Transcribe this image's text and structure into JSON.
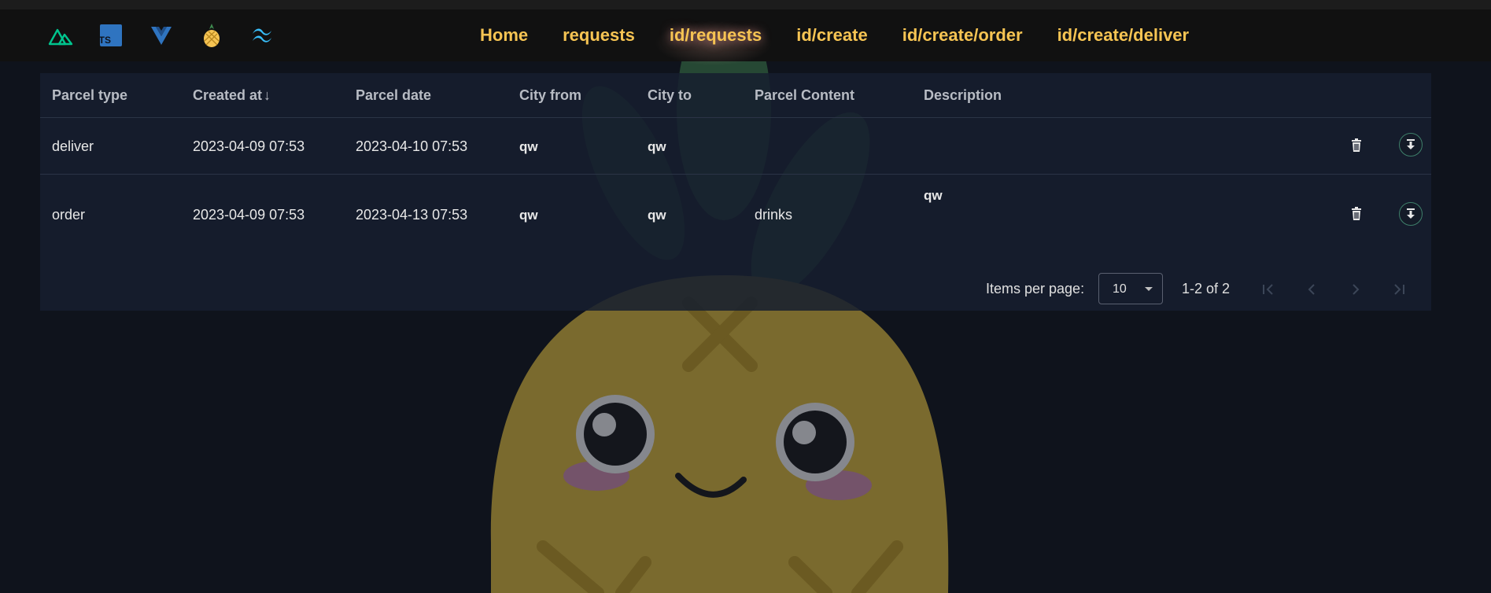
{
  "nav": {
    "logos": [
      {
        "name": "nuxt-logo-icon"
      },
      {
        "name": "typescript-logo-icon",
        "text": "TS"
      },
      {
        "name": "vue-logo-icon"
      },
      {
        "name": "pineapple-logo-icon"
      },
      {
        "name": "tailwind-logo-icon"
      }
    ],
    "links": [
      {
        "label": "Home"
      },
      {
        "label": "requests"
      },
      {
        "label": "id/requests"
      },
      {
        "label": "id/create"
      },
      {
        "label": "id/create/order"
      },
      {
        "label": "id/create/deliver"
      }
    ],
    "active_link": "id/requests",
    "link_color": "#f6c453"
  },
  "table": {
    "headers": [
      "Parcel type",
      "Created at",
      "Parcel date",
      "City from",
      "City to",
      "Parcel Content",
      "Description"
    ],
    "sort_indicator": "↓",
    "rows": [
      {
        "type": "deliver",
        "created": "2023-04-09 07:53",
        "date": "2023-04-10 07:53",
        "from": "qw",
        "to": "qw",
        "content": "",
        "description": ""
      },
      {
        "type": "order",
        "created": "2023-04-09 07:53",
        "date": "2023-04-13 07:53",
        "from": "qw",
        "to": "qw",
        "content": "drinks",
        "description": "qw"
      }
    ],
    "row_actions": [
      "trash-icon",
      "download-icon"
    ]
  },
  "pagination": {
    "items_per_page_label": "Items per page:",
    "items_per_page_value": "10",
    "range_text": "1-2 of 2"
  },
  "colors": {
    "background": "#0f131c",
    "panel": "#161e2e",
    "accent": "#f6c453",
    "mascot": "#7a6a2e"
  }
}
